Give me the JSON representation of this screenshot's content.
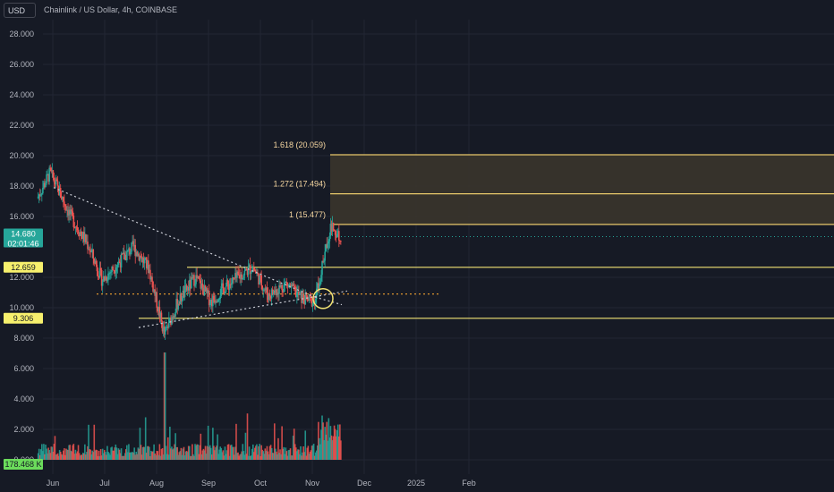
{
  "header": {
    "currency": "USD",
    "title": "Chainlink / US Dollar, 4h, COINBASE"
  },
  "price_axis": {
    "labels": [
      "28.000",
      "26.000",
      "24.000",
      "22.000",
      "20.000",
      "18.000",
      "16.000",
      "12.000",
      "10.000",
      "8.000",
      "6.000",
      "4.000",
      "2.000",
      "0.000"
    ]
  },
  "time_axis": {
    "labels": [
      "Jun",
      "Jul",
      "Aug",
      "Sep",
      "Oct",
      "Nov",
      "Dec",
      "2025",
      "Feb"
    ]
  },
  "tags": {
    "current_price": "14.680",
    "countdown": "02:01:46",
    "level_upper": "12.659",
    "level_lower": "9.306",
    "volume": "178.468 K"
  },
  "fib_labels": [
    "1.618 (20.059)",
    "1.272 (17.494)",
    "1 (15.477)"
  ],
  "colors": {
    "background": "#161a25",
    "up": "#26a69a",
    "down": "#ef5350",
    "level": "#f2e374",
    "fib_line": "#e8c86a",
    "fib_zone": "#3a352c",
    "current_tag": "#26a69a",
    "volume_tag": "#6bdc5b",
    "level_tag": "#f7f06d",
    "dotted_trend": "#c9ccd4",
    "dotted_level": "#f0a030"
  },
  "chart_data": {
    "type": "candlestick",
    "symbol": "Chainlink / US Dollar",
    "interval": "4h",
    "exchange": "COINBASE",
    "ylim": [
      0,
      29
    ],
    "y_ticks": [
      0,
      2,
      4,
      6,
      8,
      10,
      12,
      16,
      18,
      20,
      22,
      24,
      26,
      28
    ],
    "x_ticks": [
      "Jun",
      "Jul",
      "Aug",
      "Sep",
      "Oct",
      "Nov",
      "Dec",
      "2025",
      "Feb"
    ],
    "price_path": [
      [
        "late May",
        17.2
      ],
      [
        "early Jun",
        18.9
      ],
      [
        "mid Jun",
        16.0
      ],
      [
        "late Jun",
        14.0
      ],
      [
        "early Jul",
        11.8
      ],
      [
        "mid Jul",
        14.0
      ],
      [
        "late Jul",
        12.6
      ],
      [
        "early Aug",
        8.2
      ],
      [
        "mid Aug",
        10.3
      ],
      [
        "late Aug",
        12.0
      ],
      [
        "Sep",
        10.4
      ],
      [
        "mid Sep",
        11.3
      ],
      [
        "late Sep",
        12.7
      ],
      [
        "Oct",
        10.8
      ],
      [
        "mid Oct",
        11.6
      ],
      [
        "late Oct",
        10.6
      ],
      [
        "early Nov",
        10.4
      ],
      [
        "mid Nov",
        15.3
      ],
      [
        "latest",
        14.68
      ]
    ],
    "current_price": 14.68,
    "horizontal_levels": [
      12.659,
      9.306
    ],
    "dotted_level": 10.9,
    "fibonacci_extension": [
      {
        "ratio": "1",
        "price": 15.477
      },
      {
        "ratio": "1.272",
        "price": 17.494
      },
      {
        "ratio": "1.618",
        "price": 20.059
      }
    ],
    "volume_last": "178.468 K",
    "grid": true
  }
}
